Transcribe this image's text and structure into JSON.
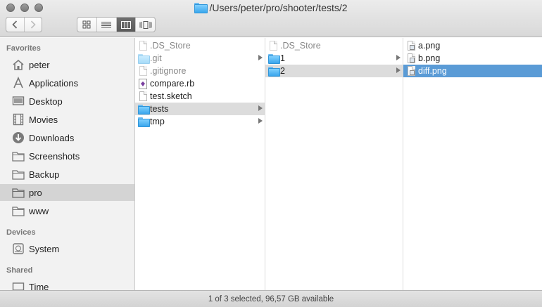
{
  "window": {
    "title": "/Users/peter/pro/shooter/tests/2",
    "status": "1 of 3 selected, 96,57 GB available"
  },
  "toolbar": {
    "back_icon": "chevron-left-icon",
    "forward_icon": "chevron-right-icon",
    "views": [
      "icon-view",
      "list-view",
      "column-view",
      "cover-flow-view"
    ],
    "active_view": "column-view"
  },
  "sidebar": {
    "favorites_heading": "Favorites",
    "favorites": [
      {
        "label": "peter",
        "icon": "home-icon"
      },
      {
        "label": "Applications",
        "icon": "applications-icon"
      },
      {
        "label": "Desktop",
        "icon": "desktop-icon"
      },
      {
        "label": "Movies",
        "icon": "movies-icon"
      },
      {
        "label": "Downloads",
        "icon": "downloads-icon"
      },
      {
        "label": "Screenshots",
        "icon": "folder-icon"
      },
      {
        "label": "Backup",
        "icon": "folder-icon"
      },
      {
        "label": "pro",
        "icon": "folder-icon",
        "selected": true
      },
      {
        "label": "www",
        "icon": "folder-icon"
      }
    ],
    "devices_heading": "Devices",
    "devices": [
      {
        "label": "System",
        "icon": "hard-drive-icon"
      }
    ],
    "shared_heading": "Shared",
    "shared": [
      {
        "label": "Time",
        "icon": "network-computer-icon"
      }
    ]
  },
  "columns": [
    {
      "items": [
        {
          "label": ".DS_Store",
          "kind": "hidden-file"
        },
        {
          "label": ".git",
          "kind": "hidden-folder",
          "has_children": true
        },
        {
          "label": ".gitignore",
          "kind": "hidden-file"
        },
        {
          "label": "compare.rb",
          "kind": "ruby-file"
        },
        {
          "label": "test.sketch",
          "kind": "file"
        },
        {
          "label": "tests",
          "kind": "folder",
          "has_children": true,
          "selected": true
        },
        {
          "label": "tmp",
          "kind": "folder",
          "has_children": true
        }
      ]
    },
    {
      "items": [
        {
          "label": ".DS_Store",
          "kind": "hidden-file"
        },
        {
          "label": "1",
          "kind": "folder",
          "has_children": true
        },
        {
          "label": "2",
          "kind": "folder",
          "has_children": true,
          "selected": true
        }
      ]
    },
    {
      "items": [
        {
          "label": "a.png",
          "kind": "image-file"
        },
        {
          "label": "b.png",
          "kind": "image-file"
        },
        {
          "label": "diff.png",
          "kind": "image-file",
          "selected": true,
          "focused": true
        }
      ]
    }
  ],
  "colors": {
    "selection_focused": "#5a9bd6",
    "selection_unfocused": "#dcdcdc",
    "folder_blue": "#3aa6ec"
  }
}
